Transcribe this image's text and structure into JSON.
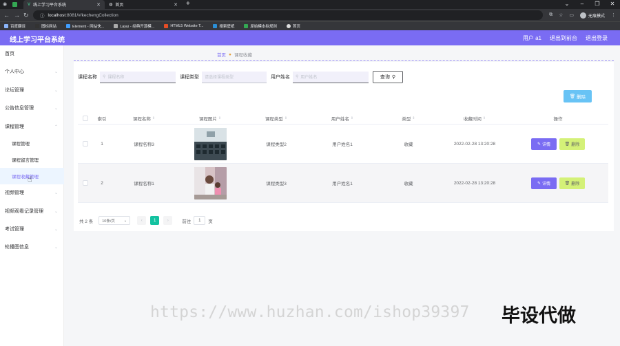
{
  "browser": {
    "tabs": [
      {
        "title": "线上学习平台系统",
        "active": true
      },
      {
        "title": "首页",
        "active": false
      }
    ],
    "url": "localhost:8081/#/kechengCollection",
    "url_host": "localhost",
    "url_rest": ":8081/#/kechengCollection",
    "profile_label": "无痕模式",
    "bookmarks": [
      "百度翻译",
      "图标网站",
      "Element - 网站快...",
      "Layui - 经典开源模...",
      "HTML5 Website T...",
      "搜索壁纸",
      "原始模本拟规则",
      "首页"
    ]
  },
  "app": {
    "title": "线上学习平台系统",
    "user": "用户 a1",
    "back_label": "退出到前台",
    "logout_label": "退出登录",
    "accent_color": "#7a6cf3"
  },
  "sidebar": {
    "items": [
      {
        "label": "首页",
        "expandable": false
      },
      {
        "label": "个人中心",
        "expandable": true
      },
      {
        "label": "论坛管理",
        "expandable": true
      },
      {
        "label": "公告信息管理",
        "expandable": true
      },
      {
        "label": "课程管理",
        "expandable": true
      },
      {
        "label": "视频管理",
        "expandable": true
      },
      {
        "label": "视频观看记录管理",
        "expandable": true
      },
      {
        "label": "考试管理",
        "expandable": true
      },
      {
        "label": "轮播图信息",
        "expandable": true
      }
    ],
    "subitems": [
      {
        "label": "课程管理",
        "active": false
      },
      {
        "label": "课程留言管理",
        "active": false
      },
      {
        "label": "课程收藏管理",
        "active": true
      }
    ]
  },
  "breadcrumb": {
    "home": "首页",
    "current": "课程收藏"
  },
  "search": {
    "course_name_label": "课程名称",
    "course_name_placeholder": "课程名称",
    "course_type_label": "课程类型",
    "course_type_placeholder": "请选择课程类型",
    "user_name_label": "用户姓名",
    "user_name_placeholder": "用户姓名",
    "search_button": "查询"
  },
  "actions": {
    "delete_button": "删除"
  },
  "table": {
    "columns": [
      "索引",
      "课程名称",
      "课程图片",
      "课程类型",
      "用户姓名",
      "类型",
      "收藏时间",
      "操作"
    ],
    "rows": [
      {
        "index": "1",
        "course_name": "课程名称3",
        "course_type": "课程类型2",
        "user_name": "用户姓名1",
        "type": "收藏",
        "time": "2022-02-28 13:20:28"
      },
      {
        "index": "2",
        "course_name": "课程名称1",
        "course_type": "课程类型3",
        "user_name": "用户姓名1",
        "type": "收藏",
        "time": "2022-02-28 13:20:28"
      }
    ],
    "detail_label": "详情",
    "delete_label": "删除"
  },
  "pagination": {
    "total": "共 2 条",
    "page_size": "10条/页",
    "current_page": "1",
    "goto_label": "前往",
    "goto_value": "1",
    "page_suffix": "页"
  },
  "overlay": {
    "watermark": "https://www.huzhan.com/ishop39397",
    "promo": "毕设代做"
  }
}
